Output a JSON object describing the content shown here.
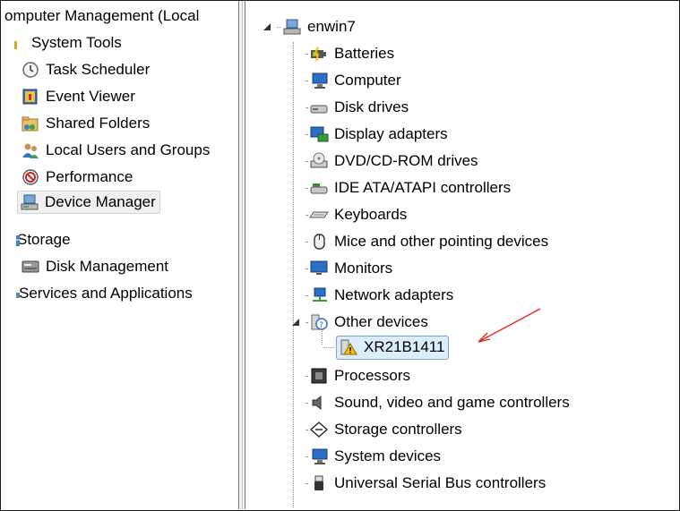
{
  "left_tree": {
    "root_label": "omputer Management (Local",
    "system_tools": "System Tools",
    "task_scheduler": "Task Scheduler",
    "event_viewer": "Event Viewer",
    "shared_folders": "Shared Folders",
    "local_users": "Local Users and Groups",
    "performance": "Performance",
    "device_manager": "Device Manager",
    "storage": "Storage",
    "disk_management": "Disk Management",
    "services": "Services and Applications"
  },
  "device_tree": {
    "computer_name": "enwin7",
    "categories": [
      "Batteries",
      "Computer",
      "Disk drives",
      "Display adapters",
      "DVD/CD-ROM drives",
      "IDE ATA/ATAPI controllers",
      "Keyboards",
      "Mice and other pointing devices",
      "Monitors",
      "Network adapters",
      "Other devices",
      "XR21B1411",
      "Processors",
      "Sound, video and game controllers",
      "Storage controllers",
      "System devices",
      "Universal Serial Bus controllers"
    ]
  },
  "colors": {
    "annotation_arrow": "#e0241b",
    "selection_fill": "#dbecfb",
    "selection_border": "#7da2ce",
    "warning": "#f2c010"
  }
}
